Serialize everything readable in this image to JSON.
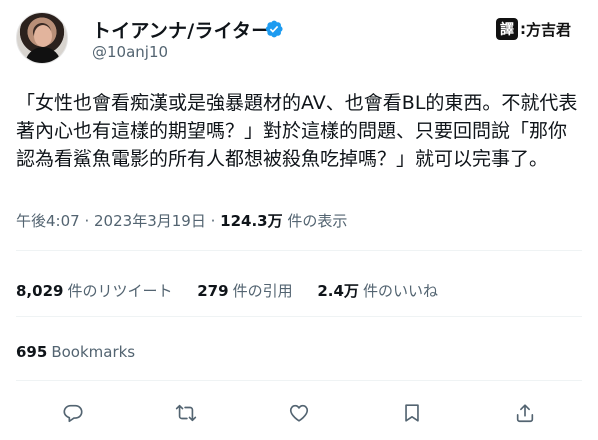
{
  "author": {
    "display_name": "トイアンナ/ライター",
    "handle": "@10anj10",
    "verified": true
  },
  "translator_tag": {
    "label": "譯",
    "name": "方吉君"
  },
  "tweet": {
    "text": "「女性也會看痴漢或是強暴題材的AV、也會看BL的東西。不就代表著內心也有這樣的期望嗎？」對於這樣的問題、只要回問說「那你認為看鯊魚電影的所有人都想被殺魚吃掉嗎？」就可以完事了。"
  },
  "meta": {
    "time": "午後4:07",
    "date": "2023年3月19日",
    "views_count": "124.3万",
    "views_label": "件の表示"
  },
  "stats": {
    "retweets_count": "8,029",
    "retweets_label": "件のリツイート",
    "quotes_count": "279",
    "quotes_label": "件の引用",
    "likes_count": "2.4万",
    "likes_label": "件のいいね"
  },
  "bookmarks": {
    "count": "695",
    "label": "Bookmarks"
  },
  "actions": [
    {
      "icon": "reply-icon"
    },
    {
      "icon": "retweet-icon"
    },
    {
      "icon": "like-icon"
    },
    {
      "icon": "bookmark-icon"
    },
    {
      "icon": "share-icon"
    }
  ],
  "colors": {
    "text": "#0f1419",
    "secondary": "#536471",
    "verified": "#1d9bf0",
    "divider": "#eff3f4"
  }
}
